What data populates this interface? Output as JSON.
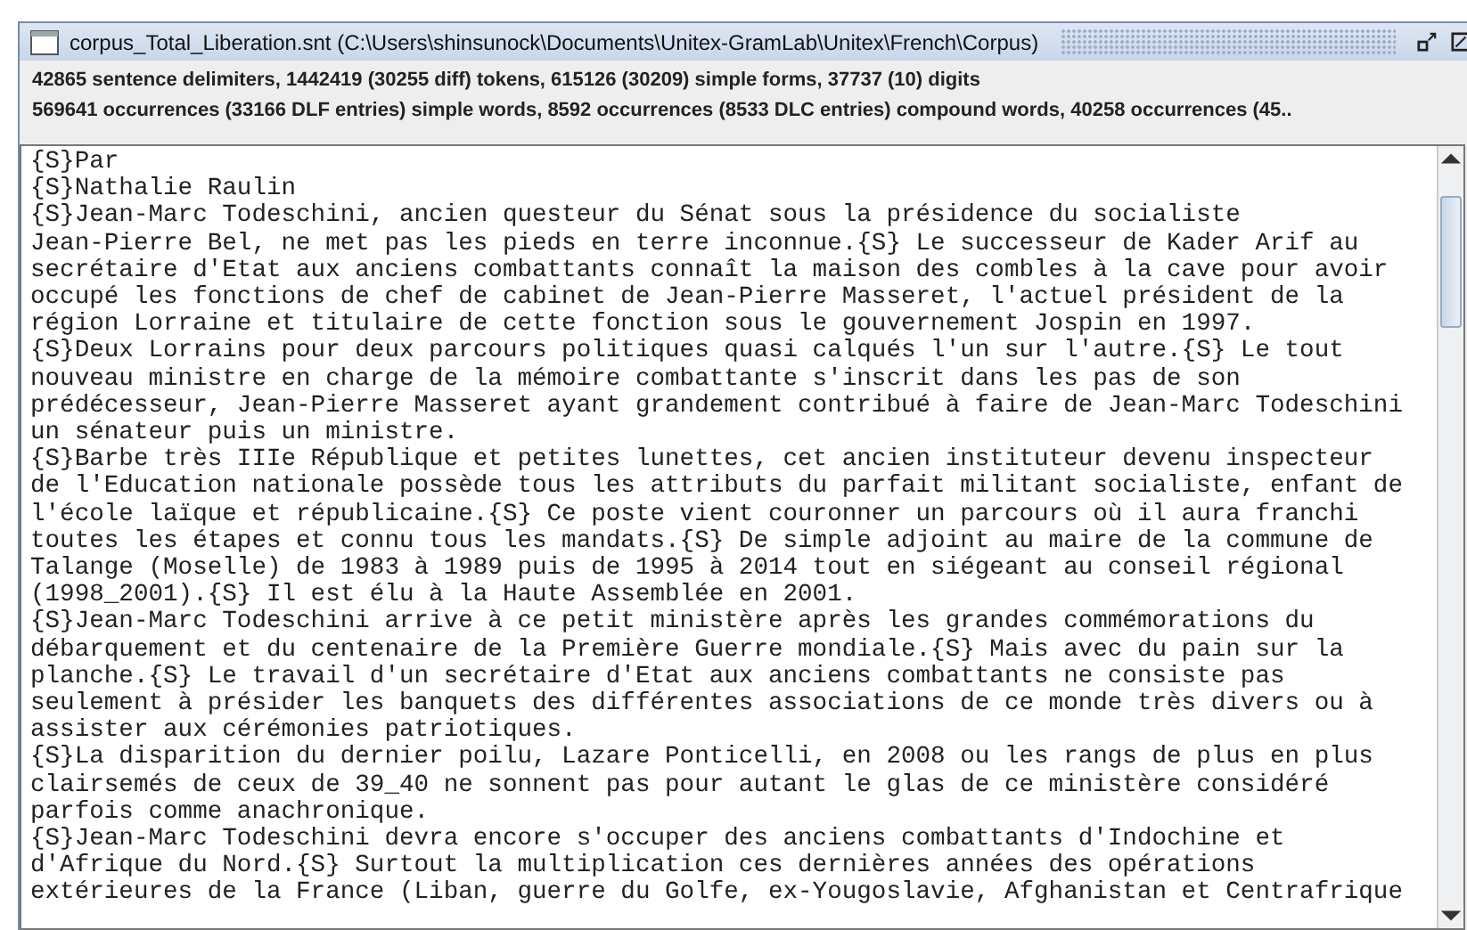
{
  "window": {
    "title": "corpus_Total_Liberation.snt (C:\\Users\\shinsunock\\Documents\\Unitex-GramLab\\Unitex\\French\\Corpus)"
  },
  "stats": [
    "42865 sentence delimiters, 1442419 (30255 diff) tokens, 615126 (30209) simple forms, 37737 (10) digits",
    "569641 occurrences (33166 DLF entries) simple words, 8592 occurrences (8533 DLC entries) compound words, 40258 occurrences (45.."
  ],
  "lines": [
    "{S}Par",
    "{S}Nathalie Raulin",
    "{S}Jean-Marc Todeschini, ancien questeur du Sénat sous la présidence du socialiste",
    "Jean-Pierre Bel, ne met pas les pieds en terre inconnue.{S} Le successeur de Kader Arif au",
    "secrétaire d'Etat aux anciens combattants connaît la maison des combles à la cave pour avoir",
    "occupé les fonctions de chef de cabinet de Jean-Pierre Masseret, l'actuel président de la",
    "région Lorraine et titulaire de cette fonction sous le gouvernement Jospin en 1997.",
    "{S}Deux Lorrains pour deux parcours politiques quasi calqués l'un sur l'autre.{S} Le tout",
    "nouveau ministre en charge de la mémoire combattante s'inscrit dans les pas de son",
    "prédécesseur, Jean-Pierre Masseret ayant grandement contribué à faire de Jean-Marc Todeschini",
    "un sénateur puis un ministre.",
    "{S}Barbe très IIIe République et petites lunettes, cet ancien instituteur devenu inspecteur",
    "de l'Education nationale possède tous les attributs du parfait militant socialiste, enfant de",
    "l'école laïque et républicaine.{S} Ce poste vient couronner un parcours où il aura franchi",
    "toutes les étapes et connu tous les mandats.{S} De simple adjoint au maire de la commune de",
    "Talange (Moselle) de 1983 à 1989 puis de 1995 à 2014 tout en siégeant au conseil régional",
    "(1998_2001).{S} Il est élu à la Haute Assemblée en 2001.",
    "{S}Jean-Marc Todeschini arrive à ce petit ministère après les grandes commémorations du",
    "débarquement et du centenaire de la Première Guerre mondiale.{S} Mais avec du pain sur la",
    "planche.{S} Le travail d'un secrétaire d'Etat aux anciens combattants ne consiste pas",
    "seulement à présider les banquets des différentes associations de ce monde très divers ou à",
    "assister aux cérémonies patriotiques.",
    "{S}La disparition du dernier poilu, Lazare Ponticelli, en 2008 ou les rangs de plus en plus",
    "clairsemés de ceux de 39_40 ne sonnent pas pour autant le glas de ce ministère considéré",
    "parfois comme anachronique.",
    "{S}Jean-Marc Todeschini devra encore s'occuper des anciens combattants d'Indochine et",
    "d'Afrique du Nord.{S} Surtout la multiplication ces dernières années des opérations",
    "extérieures de la France (Liban, guerre du Golfe, ex-Yougoslavie, Afghanistan et Centrafrique"
  ]
}
